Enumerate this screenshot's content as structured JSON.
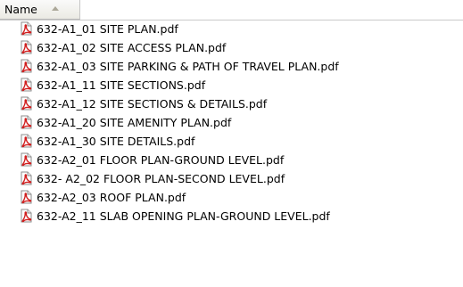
{
  "header": {
    "name_label": "Name"
  },
  "files": [
    {
      "name": "632-A1_01 SITE PLAN.pdf",
      "icon": "pdf-icon"
    },
    {
      "name": "632-A1_02 SITE ACCESS PLAN.pdf",
      "icon": "pdf-icon"
    },
    {
      "name": "632-A1_03 SITE PARKING & PATH OF TRAVEL PLAN.pdf",
      "icon": "pdf-icon"
    },
    {
      "name": "632-A1_11 SITE SECTIONS.pdf",
      "icon": "pdf-icon"
    },
    {
      "name": "632-A1_12 SITE SECTIONS & DETAILS.pdf",
      "icon": "pdf-icon"
    },
    {
      "name": "632-A1_20 SITE AMENITY PLAN.pdf",
      "icon": "pdf-icon"
    },
    {
      "name": "632-A1_30 SITE DETAILS.pdf",
      "icon": "pdf-icon"
    },
    {
      "name": "632-A2_01 FLOOR PLAN-GROUND LEVEL.pdf",
      "icon": "pdf-icon"
    },
    {
      "name": "632- A2_02 FLOOR PLAN-SECOND LEVEL.pdf",
      "icon": "pdf-icon"
    },
    {
      "name": "632-A2_03 ROOF PLAN.pdf",
      "icon": "pdf-icon"
    },
    {
      "name": "632-A2_11 SLAB OPENING PLAN-GROUND LEVEL.pdf",
      "icon": "pdf-icon"
    }
  ],
  "colors": {
    "pdf_red": "#d11d1d",
    "header_border": "#b9b9b9",
    "sort_arrow": "#aca899"
  }
}
